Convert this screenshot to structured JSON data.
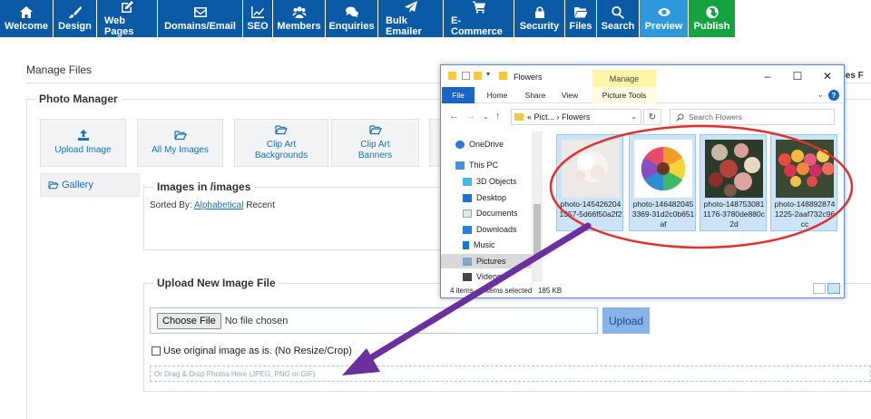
{
  "toolbar": {
    "items": [
      {
        "label": "Welcome",
        "icon": "home-icon"
      },
      {
        "label": "Design",
        "icon": "brush-icon"
      },
      {
        "label": "Web Pages",
        "icon": "edit-icon"
      },
      {
        "label": "Domains/Email",
        "icon": "envelope-icon"
      },
      {
        "label": "SEO",
        "icon": "chart-icon"
      },
      {
        "label": "Members",
        "icon": "users-icon"
      },
      {
        "label": "Enquiries",
        "icon": "comments-icon"
      },
      {
        "label": "Bulk Emailer",
        "icon": "paper-plane-icon"
      },
      {
        "label": "E-Commerce",
        "icon": "cart-icon"
      },
      {
        "label": "Security",
        "icon": "lock-icon"
      },
      {
        "label": "Files",
        "icon": "folder-icon"
      },
      {
        "label": "Search",
        "icon": "search-icon"
      },
      {
        "label": "Preview",
        "icon": "eye-icon"
      },
      {
        "label": "Publish",
        "icon": "globe-icon"
      }
    ],
    "colors": {
      "primary": "#0b5aa5",
      "preview": "#2d98dc",
      "publish": "#15a33f"
    }
  },
  "manage_files": {
    "title": "Manage Files",
    "right_fragment": "les  F"
  },
  "photo_manager": {
    "title": "Photo Manager",
    "tiles": [
      {
        "label": "Upload Image",
        "icon": "upload-icon"
      },
      {
        "label": "All My Images",
        "icon": "folder-open-icon"
      },
      {
        "label": "Clip Art\nBackgrounds",
        "icon": "folder-open-icon"
      },
      {
        "label": "Clip Art\nBanners",
        "icon": "folder-open-icon"
      }
    ],
    "gallery_label": "Gallery"
  },
  "images_panel": {
    "title": "Images in /images",
    "sorted_by": "Sorted By:",
    "sort_alpha": "Alphabetical",
    "sort_recent": "Recent"
  },
  "upload": {
    "title": "Upload New Image File",
    "choose_file": "Choose File",
    "no_file": "No file chosen",
    "upload_button": "Upload",
    "original_label": "Use original image as is. (No Resize/Crop)",
    "dropzone": "Or Drag & Drop Photos Here (JPEG, PNG or GIF)"
  },
  "explorer": {
    "title": "Flowers",
    "manage_tab": "Manage",
    "ribbon_tabs": [
      "File",
      "Home",
      "Share",
      "View",
      "Picture Tools"
    ],
    "address": "« Pict...  ›  Flowers",
    "search_placeholder": "Search Flowers",
    "nav": [
      {
        "label": "OneDrive",
        "icon": "cloud-icon"
      },
      {
        "label": "This PC",
        "icon": "pc-icon"
      },
      {
        "label": "3D Objects",
        "icon": "cube-icon"
      },
      {
        "label": "Desktop",
        "icon": "desktop-icon"
      },
      {
        "label": "Documents",
        "icon": "document-icon"
      },
      {
        "label": "Downloads",
        "icon": "download-icon"
      },
      {
        "label": "Music",
        "icon": "music-icon"
      },
      {
        "label": "Pictures",
        "icon": "pictures-icon"
      },
      {
        "label": "Videos",
        "icon": "video-icon"
      }
    ],
    "files": [
      {
        "name": "photo-145426204 1357-5d66f50a2f2"
      },
      {
        "name": "photo-146482045 3369-31d2c0b651 af"
      },
      {
        "name": "photo-148753081 1176-3780de880c 2d"
      },
      {
        "name": "photo-148892874 1225-2aaf732c96 cc"
      }
    ],
    "status_items": "4 items",
    "status_selected": "4 items selected",
    "status_size": "185 KB"
  },
  "annotation": {
    "ellipse_color": "#e0312f",
    "arrow_color": "#6b2f9e"
  }
}
